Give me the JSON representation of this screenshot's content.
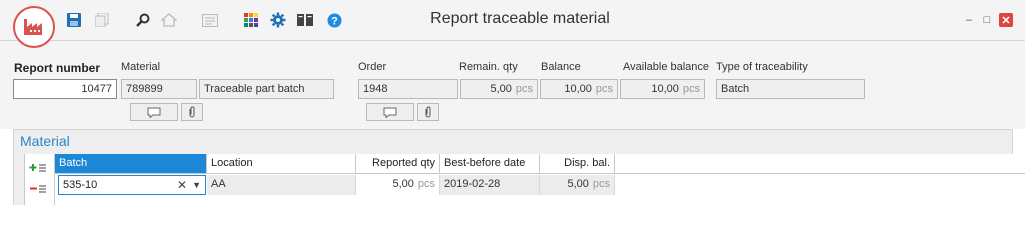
{
  "window": {
    "title": "Report traceable material",
    "controls": {
      "minimize": "–",
      "restore": "□",
      "close": "✕"
    }
  },
  "toolbar": {
    "icons": [
      "app-logo-factory-icon",
      "save-icon",
      "copy-icon",
      "search-icon",
      "home-icon",
      "form-icon",
      "grid-icon",
      "settings-icon",
      "book-icon",
      "help-icon"
    ]
  },
  "header": {
    "report_number_label": "Report number",
    "report_number": "10477",
    "material_label": "Material",
    "material_code": "789899",
    "material_name": "Traceable part batch",
    "order_label": "Order",
    "order": "1948",
    "remain_qty_label": "Remain. qty",
    "remain_qty": "5,00",
    "balance_label": "Balance",
    "balance": "10,00",
    "available_balance_label": "Available balance",
    "available_balance": "10,00",
    "unit": "pcs",
    "traceability_label": "Type of traceability",
    "traceability": "Batch"
  },
  "material_panel": {
    "title": "Material",
    "columns": [
      "Batch",
      "Location",
      "Reported qty",
      "Best-before date",
      "Disp. bal."
    ],
    "rows": [
      {
        "batch": "535-10",
        "location": "AA",
        "reported_qty": "5,00",
        "best_before": "2019-02-28",
        "disp_bal": "5,00",
        "unit": "pcs"
      }
    ]
  },
  "colors": {
    "accent": "#1e88d8",
    "logo": "#d9534f",
    "close": "#e04343"
  }
}
